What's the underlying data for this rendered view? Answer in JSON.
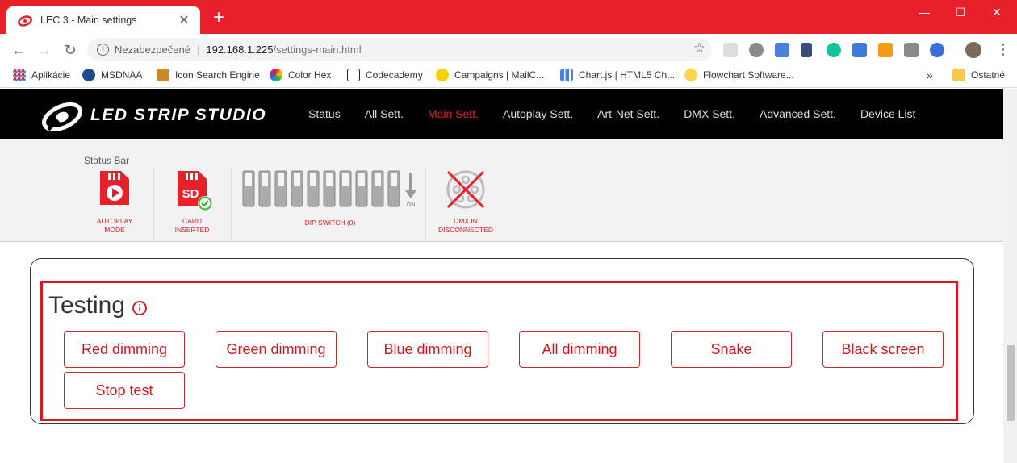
{
  "browser": {
    "tab_title": "LEC 3 - Main settings",
    "new_tab": "+",
    "minimize": "—",
    "maximize": "☐",
    "close": "✕",
    "security_label": "Nezabezpečené",
    "url_host": "192.168.1.225",
    "url_path": "/settings-main.html",
    "bookmarks": [
      {
        "label": "Aplikácie",
        "icon": "apps-grid-icon"
      },
      {
        "label": "MSDNAA",
        "icon": "otb-icon"
      },
      {
        "label": "Icon Search Engine",
        "icon": "icon-search-icon"
      },
      {
        "label": "Color Hex",
        "icon": "color-hex-icon"
      },
      {
        "label": "Codecademy",
        "icon": "codecademy-icon"
      },
      {
        "label": "Campaigns | MailC...",
        "icon": "mailchimp-icon"
      },
      {
        "label": "Chart.js | HTML5 Ch...",
        "icon": "chart-icon"
      },
      {
        "label": "Flowchart Software...",
        "icon": "lightbulb-icon"
      }
    ],
    "bookmarks_overflow": "»",
    "other_bookmarks": "Ostatné"
  },
  "site": {
    "logo_text": "LED STRIP STUDIO",
    "menu": [
      "Status",
      "All Sett.",
      "Main Sett.",
      "Autoplay Sett.",
      "Art-Net Sett.",
      "DMX Sett.",
      "Advanced Sett.",
      "Device List"
    ],
    "active_menu": "Main Sett.",
    "accent_color": "#e8202a"
  },
  "status_bar": {
    "heading": "Status Bar",
    "autoplay_line1": "AUTOPLAY",
    "autoplay_line2": "MODE",
    "card_line1": "CARD",
    "card_line2": "INSERTED",
    "card_icon_text": "SD",
    "dip_label": "DIP SWITCH (0)",
    "dip_on_label": "ON",
    "dmx_line1": "DMX IN",
    "dmx_line2": "DISCONNECTED"
  },
  "testing": {
    "title": "Testing",
    "info_glyph": "i",
    "buttons": [
      "Red dimming",
      "Green dimming",
      "Blue dimming",
      "All dimming",
      "Snake",
      "Black screen",
      "Stop test"
    ]
  }
}
